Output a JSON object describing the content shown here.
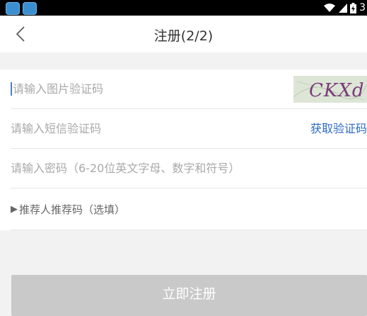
{
  "status_bar": {
    "time": "3",
    "icons": [
      "app-icon",
      "app-icon",
      "wifi-icon",
      "signal-icon",
      "battery-icon"
    ]
  },
  "nav": {
    "back_icon": "chevron-left-icon",
    "title": "注册(2/2)"
  },
  "form": {
    "image_code_placeholder": "请输入图片验证码",
    "captcha_text": "CKXd",
    "sms_code_placeholder": "请输入短信验证码",
    "get_code_label": "获取验证码",
    "password_placeholder": "请输入密码（6-20位英文字母、数字和符号）",
    "referrer_arrow": "▶",
    "referrer_label": "推荐人推荐码（选填）"
  },
  "register_button": "立即注册",
  "colors": {
    "accent": "#2e6bbf",
    "button_disabled": "#c9c9c9",
    "background": "#f2f2f2"
  }
}
